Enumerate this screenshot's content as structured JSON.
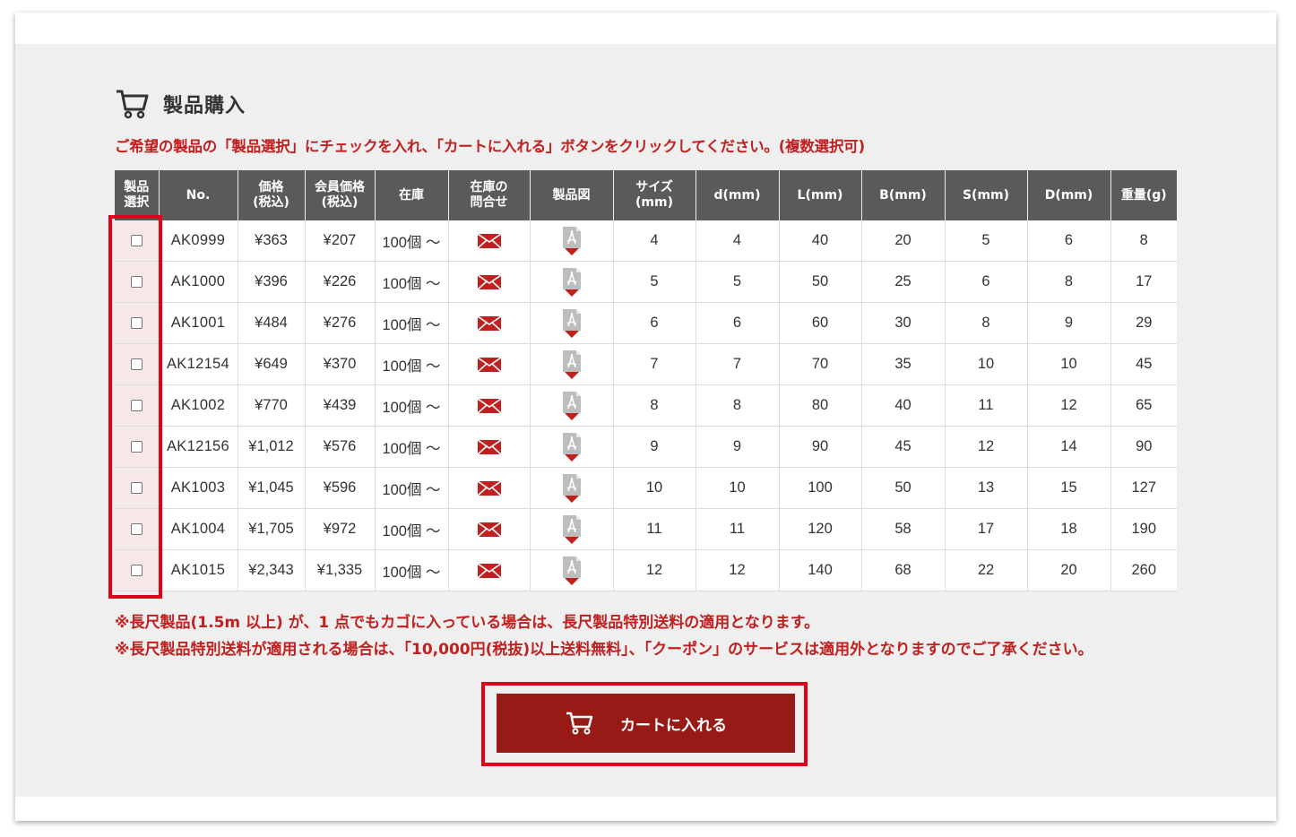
{
  "section": {
    "title": "製品購入",
    "instruction": "ご希望の製品の「製品選択」にチェックを入れ、「カートに入れる」ボタンをクリックしてください。(複数選択可)"
  },
  "table": {
    "headers": [
      {
        "line1": "製品",
        "line2": "選択"
      },
      {
        "line1": "No.",
        "line2": ""
      },
      {
        "line1": "価格",
        "line2": "(税込)"
      },
      {
        "line1": "会員価格",
        "line2": "(税込)"
      },
      {
        "line1": "在庫",
        "line2": ""
      },
      {
        "line1": "在庫の",
        "line2": "問合せ"
      },
      {
        "line1": "製品図",
        "line2": ""
      },
      {
        "line1": "サイズ",
        "line2": "(mm)"
      },
      {
        "line1": "d(mm)",
        "line2": ""
      },
      {
        "line1": "L(mm)",
        "line2": ""
      },
      {
        "line1": "B(mm)",
        "line2": ""
      },
      {
        "line1": "S(mm)",
        "line2": ""
      },
      {
        "line1": "D(mm)",
        "line2": ""
      },
      {
        "line1": "重量(g)",
        "line2": ""
      }
    ],
    "rows": [
      {
        "no": "AK0999",
        "price": "¥363",
        "member": "¥207",
        "stock": "100個 ～",
        "size": "4",
        "d": "4",
        "L": "40",
        "B": "20",
        "S": "5",
        "D": "6",
        "weight": "8"
      },
      {
        "no": "AK1000",
        "price": "¥396",
        "member": "¥226",
        "stock": "100個 ～",
        "size": "5",
        "d": "5",
        "L": "50",
        "B": "25",
        "S": "6",
        "D": "8",
        "weight": "17"
      },
      {
        "no": "AK1001",
        "price": "¥484",
        "member": "¥276",
        "stock": "100個 ～",
        "size": "6",
        "d": "6",
        "L": "60",
        "B": "30",
        "S": "8",
        "D": "9",
        "weight": "29"
      },
      {
        "no": "AK12154",
        "price": "¥649",
        "member": "¥370",
        "stock": "100個 ～",
        "size": "7",
        "d": "7",
        "L": "70",
        "B": "35",
        "S": "10",
        "D": "10",
        "weight": "45"
      },
      {
        "no": "AK1002",
        "price": "¥770",
        "member": "¥439",
        "stock": "100個 ～",
        "size": "8",
        "d": "8",
        "L": "80",
        "B": "40",
        "S": "11",
        "D": "12",
        "weight": "65"
      },
      {
        "no": "AK12156",
        "price": "¥1,012",
        "member": "¥576",
        "stock": "100個 ～",
        "size": "9",
        "d": "9",
        "L": "90",
        "B": "45",
        "S": "12",
        "D": "14",
        "weight": "90"
      },
      {
        "no": "AK1003",
        "price": "¥1,045",
        "member": "¥596",
        "stock": "100個 ～",
        "size": "10",
        "d": "10",
        "L": "100",
        "B": "50",
        "S": "13",
        "D": "15",
        "weight": "127"
      },
      {
        "no": "AK1004",
        "price": "¥1,705",
        "member": "¥972",
        "stock": "100個 ～",
        "size": "11",
        "d": "11",
        "L": "120",
        "B": "58",
        "S": "17",
        "D": "18",
        "weight": "190"
      },
      {
        "no": "AK1015",
        "price": "¥2,343",
        "member": "¥1,335",
        "stock": "100個 ～",
        "size": "12",
        "d": "12",
        "L": "140",
        "B": "68",
        "S": "22",
        "D": "20",
        "weight": "260"
      }
    ]
  },
  "notes": [
    "※長尺製品(1.5m 以上) が、1 点でもカゴに入っている場合は、長尺製品特別送料の適用となります。",
    "※長尺製品特別送料が適用される場合は、「10,000円(税抜)以上送料無料」、「クーポン」のサービスは適用外となりますのでご了承ください。"
  ],
  "cart_button": {
    "label": "カートに入れる"
  },
  "icons": {
    "heading": "cart-icon",
    "inquiry": "mail-icon",
    "drawing": "pdf-download-icon",
    "button": "cart-icon"
  },
  "colors": {
    "accent": "#c0201f",
    "button": "#981a16",
    "highlight": "#e4001b",
    "header_bg": "#5a5a5a"
  }
}
